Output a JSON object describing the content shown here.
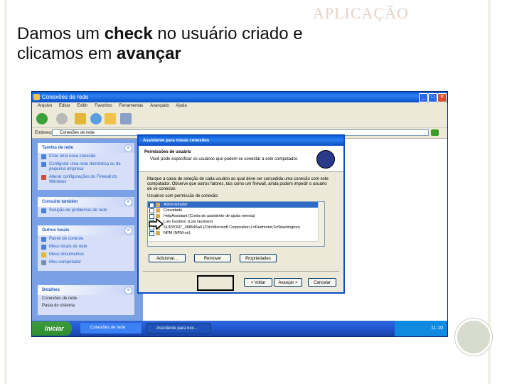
{
  "slide": {
    "watermark": "APLICAÇÃO",
    "title_part1": "Damos um ",
    "title_bold1": "check",
    "title_part2": " no usuário criado e clicamos em ",
    "title_bold2": "avançar"
  },
  "window": {
    "title": "Conexões de rede",
    "menu": [
      "Arquivo",
      "Editar",
      "Exibir",
      "Favoritos",
      "Ferramentas",
      "Avançado",
      "Ajuda"
    ],
    "address_label": "Endereço",
    "address_value": "Conexões de rede"
  },
  "taskpane": {
    "network_tasks": {
      "title": "Tarefas de rede",
      "items": [
        "Criar uma nova conexão",
        "Configurar uma rede doméstica ou de pequena empresa",
        "Alterar configurações do Firewall do Windows"
      ]
    },
    "see_also": {
      "title": "Consulte também",
      "items": [
        "Solução de problemas de rede"
      ]
    },
    "other_places": {
      "title": "Outros locais",
      "items": [
        "Painel de controle",
        "Meus locais de rede",
        "Meus documentos",
        "Meu computador"
      ]
    },
    "details": {
      "title": "Detalhes",
      "line1": "Conexões de rede",
      "line2": "Pasta do sistema"
    }
  },
  "taskbar": {
    "start": "Iniciar",
    "tasks": [
      "Conexões de rede",
      "Assistente para nov..."
    ],
    "clock": "11:10"
  },
  "dialog": {
    "title": "Assistente para novas conexões",
    "header_title": "Permissões de usuário",
    "header_sub": "Você pode especificar os usuários que podem se conectar a este computador.",
    "description": "Marque a caixa de seleção de cada usuário ao qual deve ser concedida uma conexão com este computador. Observe que outros fatores, tais como um firewall, ainda podem impedir o usuário de se conectar.",
    "list_label": "Usuários com permissão de conexão:",
    "users": [
      {
        "label": "Administrador",
        "checked": false,
        "selected": true
      },
      {
        "label": "Convidado",
        "checked": false,
        "selected": false
      },
      {
        "label": "HelpAssistant (Conta de assistente de ajuda remota)",
        "checked": false,
        "selected": false
      },
      {
        "label": "Luis Gustavo (Luis Gustavo)",
        "checked": true,
        "selected": false
      },
      {
        "label": "SUPPORT_388945a0 (CN=Microsoft Corporation,L=Redmond,S=Washington)",
        "checked": false,
        "selected": false
      },
      {
        "label": "NPM (NPM-ctr)",
        "checked": true,
        "selected": false
      }
    ],
    "add_button": "Adicionar...",
    "remove_button": "Remover",
    "properties_button": "Propriedades",
    "back_button": "< Voltar",
    "next_button": "Avançar >",
    "cancel_button": "Cancelar"
  }
}
